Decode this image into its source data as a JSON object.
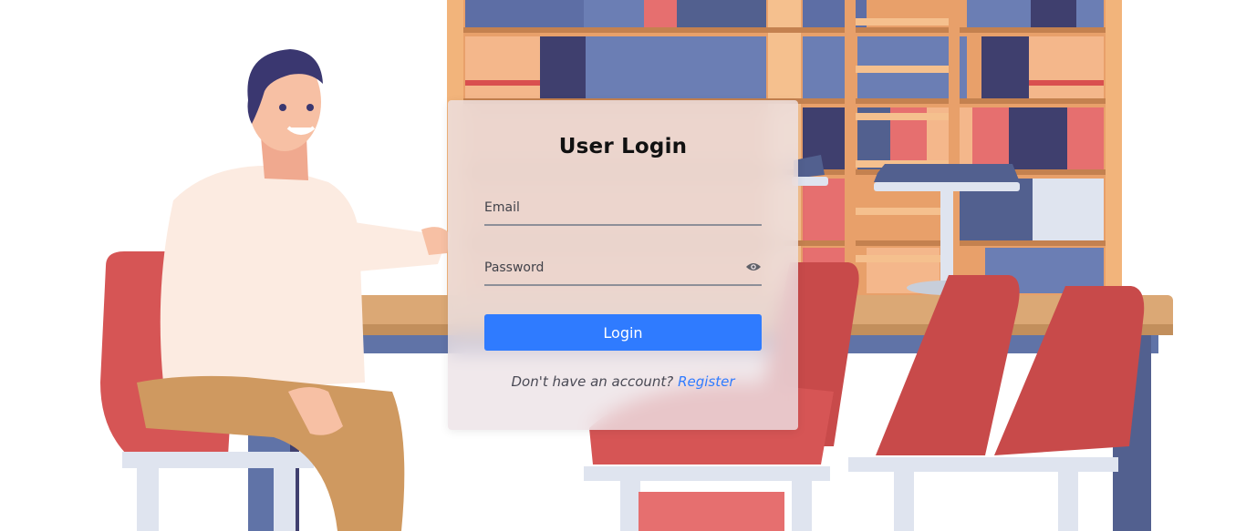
{
  "login": {
    "title": "User Login",
    "email_placeholder": "Email",
    "email_value": "",
    "password_placeholder": "Password",
    "password_value": "",
    "login_label": "Login",
    "register_prompt": "Don't have an account?",
    "register_label": "Register"
  },
  "icons": {
    "password_toggle": "eye-icon"
  },
  "colors": {
    "primary": "#2f7bff",
    "card_background": "#ece2e6",
    "field_underline": "#8d8f98",
    "bookshelf_wood": "#f2b47b",
    "chair_red": "#d65555",
    "table_top": "#dba875",
    "table_frame": "#6073a7"
  }
}
